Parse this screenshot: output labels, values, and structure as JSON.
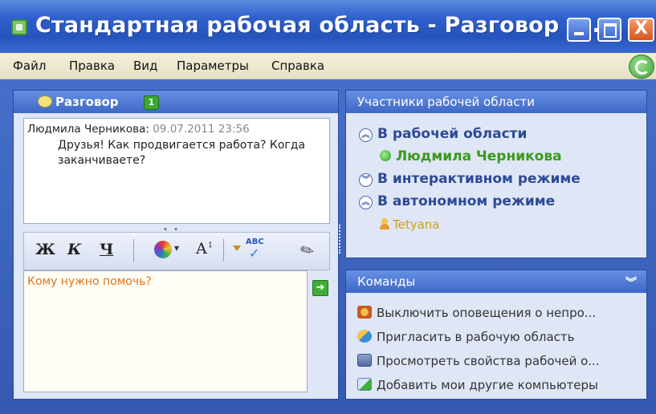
{
  "window": {
    "title": "Стандартная рабочая область - Разговор - ...",
    "icons": [
      "app-icon",
      "minimize-icon",
      "maximize-icon",
      "close-icon",
      "sync-icon"
    ],
    "close_glyph": "X"
  },
  "menu": {
    "items": [
      "Файл",
      "Правка",
      "Вид",
      "Параметры",
      "Справка"
    ]
  },
  "conversation": {
    "title": "Разговор",
    "badge": "1",
    "message": {
      "author": "Людмила Черникова:",
      "time": "09.07.2011 23:56",
      "text": "Друзья! Как продвигается работа? Когда заканчиваете?"
    },
    "splitter": "• • • • •",
    "toolbar": {
      "bold": "Ж",
      "italic": "К",
      "underline": "Ч",
      "font_size": "A",
      "spell": "ABC"
    },
    "input_text": "Кому нужно помочь?",
    "send_glyph": "➔"
  },
  "participants": {
    "title": "Участники рабочей области",
    "groups": [
      {
        "label": "В рабочей области",
        "expander": "︽"
      },
      {
        "label": "В интерактивном режиме",
        "expander": "︾"
      },
      {
        "label": "В автономном режиме",
        "expander": "︽"
      }
    ],
    "members": [
      {
        "name": "Людмила Черникова",
        "status": "online",
        "color": "#3a9a1e"
      },
      {
        "name": "Tetyana",
        "status": "offline",
        "color": "#c9a016"
      }
    ]
  },
  "commands": {
    "title": "Команды",
    "collapse_glyph": "︾",
    "items": [
      "Выключить оповещения о непро...",
      "Пригласить в рабочую область",
      "Просмотреть свойства рабочей о...",
      "Добавить мои другие компьютеры"
    ]
  }
}
